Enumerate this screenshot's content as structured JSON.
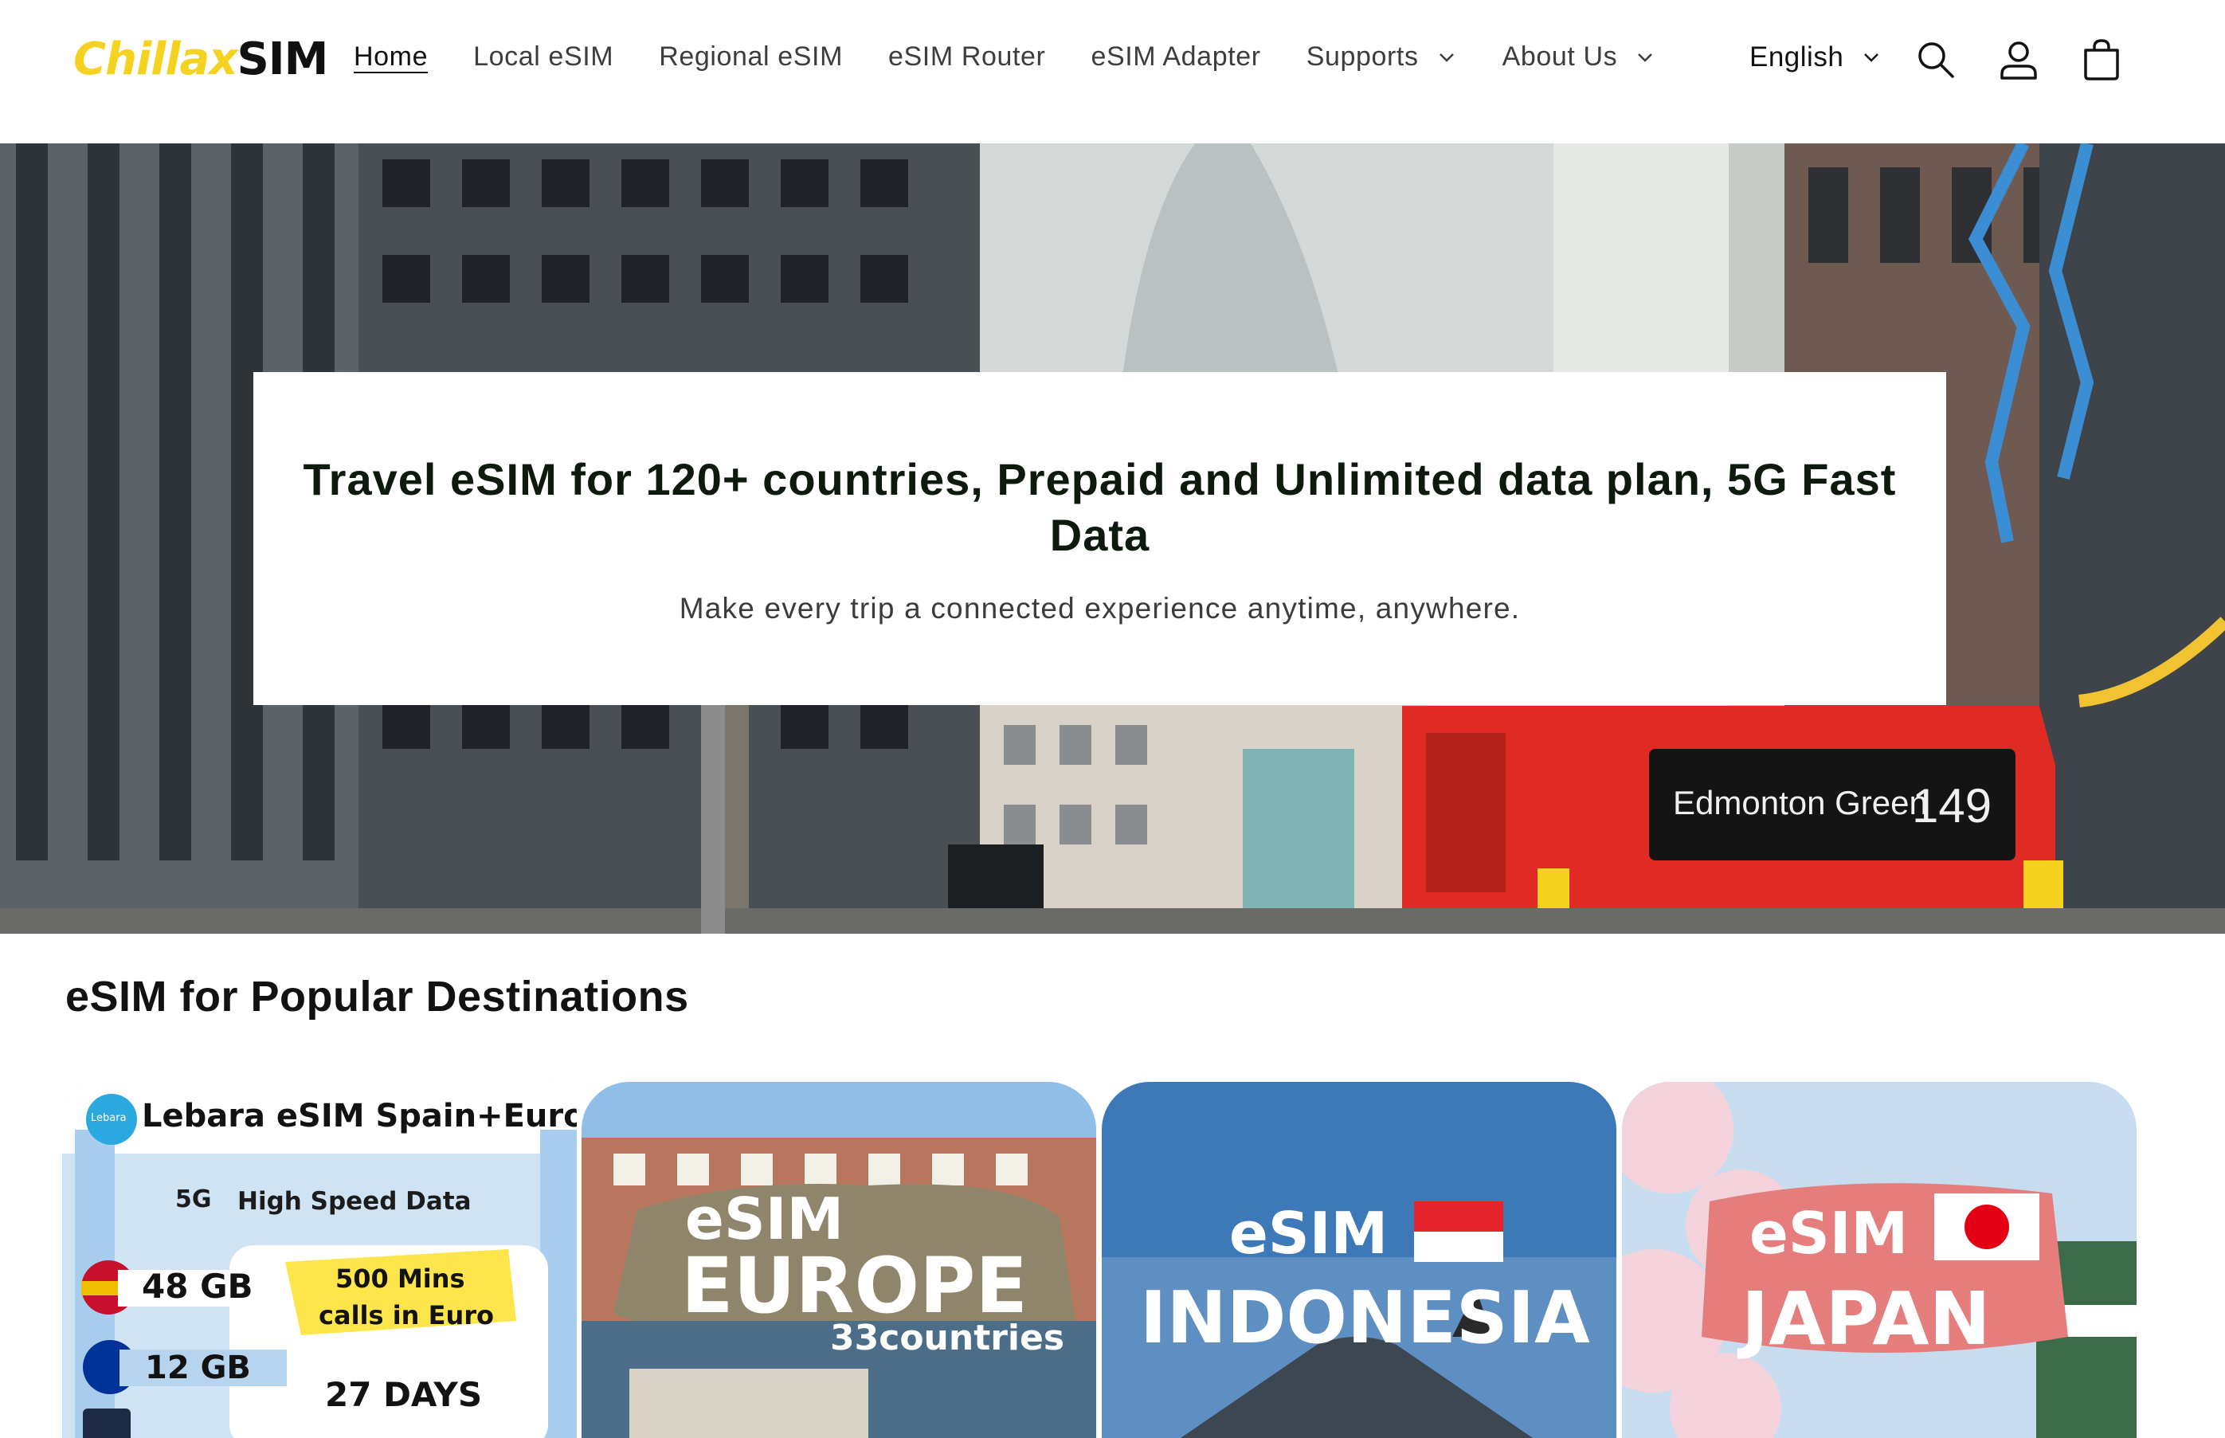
{
  "brand": {
    "logo_part1": "Chillax",
    "logo_part2": "SIM",
    "accent_color": "#f4d21f"
  },
  "nav": {
    "items": [
      {
        "label": "Home",
        "active": true
      },
      {
        "label": "Local eSIM"
      },
      {
        "label": "Regional eSIM"
      },
      {
        "label": "eSIM Router"
      },
      {
        "label": "eSIM Adapter"
      },
      {
        "label": "Supports",
        "dropdown": true
      },
      {
        "label": "About Us",
        "dropdown": true
      }
    ],
    "language": "English",
    "icons": [
      "search-icon",
      "account-icon",
      "cart-icon"
    ]
  },
  "hero": {
    "title": "Travel eSIM for 120+ countries, Prepaid and Unlimited data plan, 5G Fast Data",
    "subtitle": "Make every trip a connected experience anytime, anywhere.",
    "bus_sign": "Edmonton Green",
    "bus_number": "149"
  },
  "destinations": {
    "heading": "eSIM for Popular Destinations",
    "cards": [
      {
        "brand": "Lebara",
        "title": "Lebara eSIM Spain+Euro",
        "speed": "High Speed Data",
        "speed_badge": "5G",
        "spain_data": "48 GB",
        "euro_data": "12 GB",
        "calls_line1": "500 Mins",
        "calls_line2": "calls in Euro",
        "days": "27 DAYS"
      },
      {
        "label": "eSIM",
        "name": "EUROPE",
        "extra": "33countries"
      },
      {
        "label": "eSIM",
        "name": "INDONESIA"
      },
      {
        "label": "eSIM",
        "name": "JAPAN"
      }
    ]
  }
}
